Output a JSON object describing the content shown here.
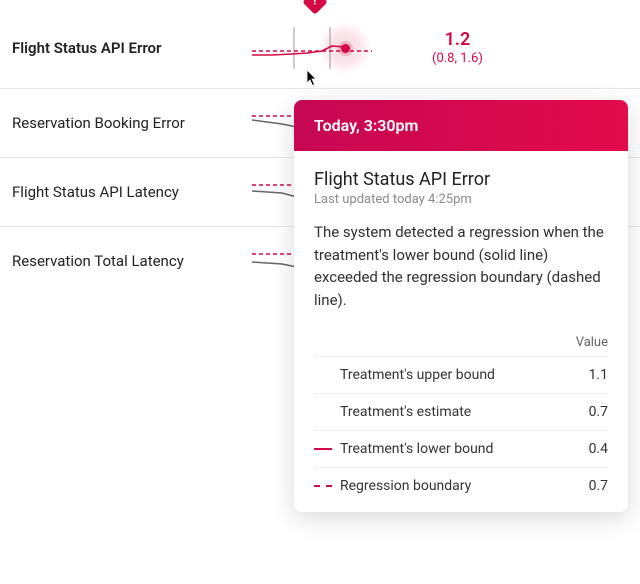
{
  "metrics": {
    "0": {
      "label": "Flight Status API Error",
      "value": "1.2",
      "ci": "(0.8, 1.6)"
    },
    "1": {
      "label": "Reservation Booking Error"
    },
    "2": {
      "label": "Flight Status API Latency"
    },
    "3": {
      "label": "Reservation Total Latency"
    }
  },
  "tooltip": {
    "header": "Today, 3:30pm",
    "title": "Flight Status API Error",
    "subtitle": "Last updated today 4:25pm",
    "description": "The system detected a regression when the treatment's lower bound (solid line) exceeded the regression boundary (dashed line).",
    "value_header": "Value",
    "rows": {
      "0": {
        "label": "Treatment's upper bound",
        "value": "1.1"
      },
      "1": {
        "label": "Treatment's estimate",
        "value": "0.7"
      },
      "2": {
        "label": "Treatment's lower bound",
        "value": "0.4"
      },
      "3": {
        "label": "Regression boundary",
        "value": "0.7"
      }
    }
  },
  "colors": {
    "accent": "#d60844"
  },
  "chart_data": [
    {
      "type": "line",
      "metric": "Flight Status API Error",
      "series": [
        {
          "name": "Treatment lower bound",
          "style": "solid",
          "values": [
            0.1,
            0.1,
            0.12,
            0.15,
            0.18,
            0.25,
            0.3,
            0.38,
            0.4
          ]
        },
        {
          "name": "Regression boundary",
          "style": "dashed",
          "values": [
            0.35,
            0.35,
            0.35,
            0.35,
            0.35,
            0.35,
            0.35,
            0.35,
            0.35
          ]
        }
      ],
      "marker": {
        "index": 8,
        "alert": true
      },
      "ylim": [
        0,
        1
      ]
    },
    {
      "type": "line",
      "metric": "Reservation Booking Error",
      "series": [
        {
          "name": "Regression boundary",
          "style": "dashed",
          "values": [
            0.55,
            0.55,
            0.55,
            0.55,
            0.55,
            0.55,
            0.55,
            0.55,
            0.55
          ]
        },
        {
          "name": "Treatment",
          "style": "solid-grey",
          "values": [
            0.48,
            0.45,
            0.4,
            0.38,
            0.3,
            0.28,
            0.25,
            0.22,
            0.2
          ]
        }
      ],
      "ylim": [
        0,
        1
      ]
    },
    {
      "type": "line",
      "metric": "Flight Status API Latency",
      "series": [
        {
          "name": "Regression boundary",
          "style": "dashed",
          "values": [
            0.55,
            0.55,
            0.55,
            0.55,
            0.55,
            0.55,
            0.55,
            0.55,
            0.55
          ]
        },
        {
          "name": "Treatment",
          "style": "solid-grey",
          "values": [
            0.4,
            0.38,
            0.37,
            0.33,
            0.25,
            0.22,
            0.2,
            0.19,
            0.18
          ]
        }
      ],
      "ylim": [
        0,
        1
      ]
    },
    {
      "type": "line",
      "metric": "Reservation Total Latency",
      "series": [
        {
          "name": "Regression boundary",
          "style": "dashed",
          "values": [
            0.55,
            0.55,
            0.55,
            0.55,
            0.55,
            0.55,
            0.55,
            0.55,
            0.55
          ]
        },
        {
          "name": "Treatment",
          "style": "solid-grey",
          "values": [
            0.38,
            0.36,
            0.34,
            0.3,
            0.26,
            0.22,
            0.18,
            0.16,
            0.15
          ]
        }
      ],
      "ylim": [
        0,
        1
      ]
    }
  ]
}
